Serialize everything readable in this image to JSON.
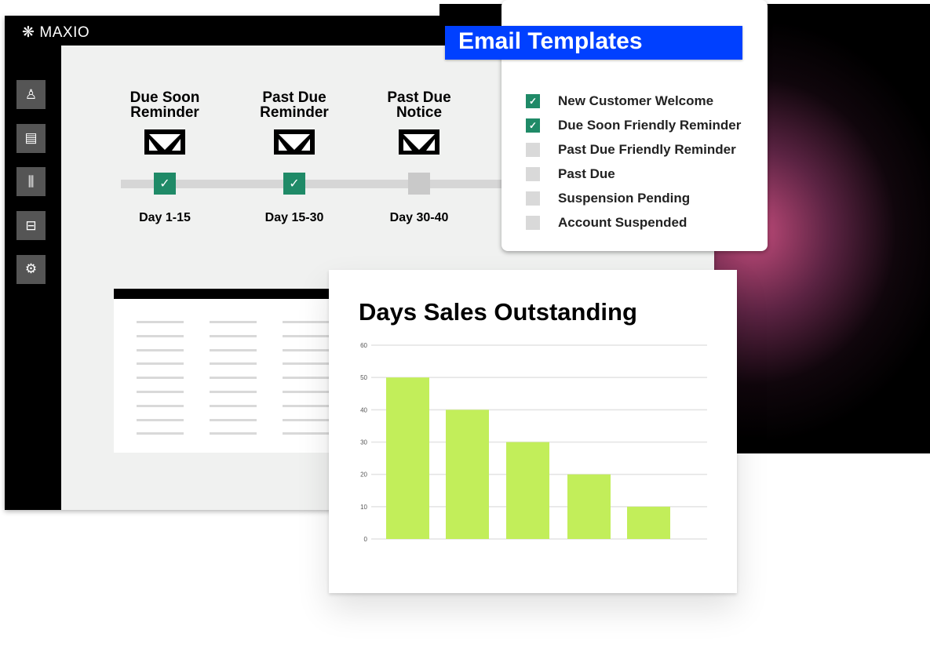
{
  "brand": {
    "name": "MAXIO",
    "logo_icon": "snowflake-asterisk"
  },
  "sidebar": {
    "items": [
      {
        "icon": "user-icon",
        "glyph": "♙"
      },
      {
        "icon": "document-icon",
        "glyph": "▤"
      },
      {
        "icon": "bar-chart-icon",
        "glyph": "⫼"
      },
      {
        "icon": "briefcase-icon",
        "glyph": "⊟"
      },
      {
        "icon": "gear-icon",
        "glyph": "⚙"
      }
    ]
  },
  "steps": [
    {
      "title": "Due Soon Reminder",
      "day": "Day 1-15",
      "checked": true
    },
    {
      "title": "Past Due Reminder",
      "day": "Day 15-30",
      "checked": true
    },
    {
      "title": "Past Due Notice",
      "day": "Day 30-40",
      "checked": false
    }
  ],
  "email_templates": {
    "title": "Email Templates",
    "items": [
      {
        "label": "New Customer Welcome",
        "checked": true
      },
      {
        "label": "Due Soon Friendly Reminder",
        "checked": true
      },
      {
        "label": "Past Due Friendly Reminder",
        "checked": false
      },
      {
        "label": "Past Due",
        "checked": false
      },
      {
        "label": "Suspension Pending",
        "checked": false
      },
      {
        "label": "Account Suspended",
        "checked": false
      }
    ]
  },
  "colors": {
    "check_green": "#1f8a67",
    "unchecked": "#d9d9d9",
    "title_blue": "#0040ff",
    "bar": "#c2ee5a"
  },
  "chart_data": {
    "type": "bar",
    "title": "Days Sales Outstanding",
    "categories": [
      "",
      "",
      "",
      "",
      ""
    ],
    "values": [
      50,
      40,
      30,
      20,
      10
    ],
    "ylim": [
      0,
      60
    ],
    "yticks": [
      0,
      10,
      20,
      30,
      40,
      50,
      60
    ],
    "grid": true,
    "xlabel": "",
    "ylabel": ""
  }
}
